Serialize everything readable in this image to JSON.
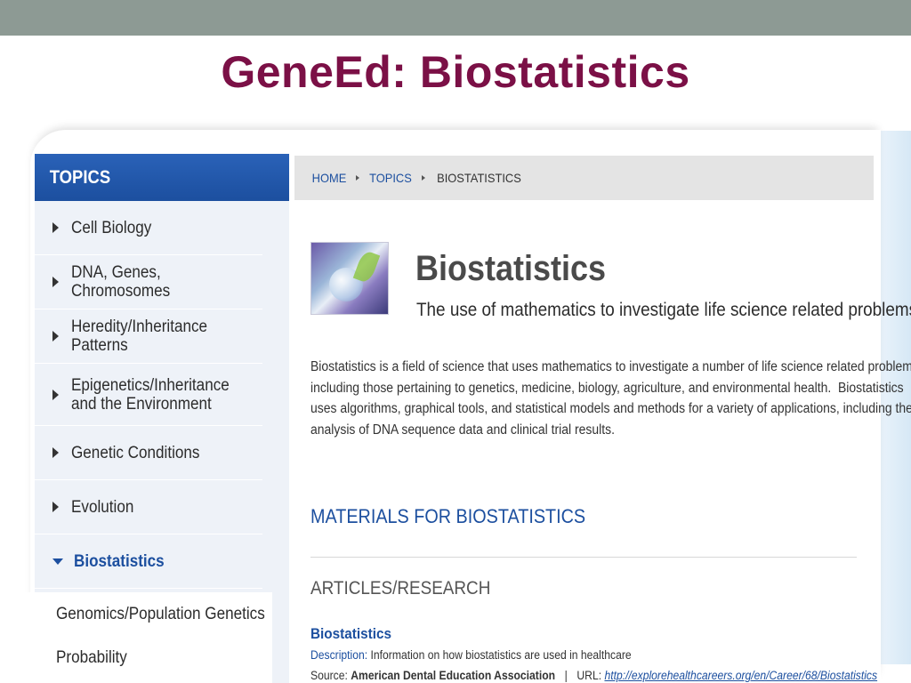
{
  "slide": {
    "title": "GeneEd: Biostatistics"
  },
  "sidebar": {
    "header": "TOPICS",
    "items": [
      {
        "label": "Cell Biology"
      },
      {
        "label": "DNA, Genes, Chromosomes"
      },
      {
        "label": "Heredity/Inheritance Patterns"
      },
      {
        "label": "Epigenetics/Inheritance and the Environment"
      },
      {
        "label": "Genetic Conditions"
      },
      {
        "label": "Evolution"
      },
      {
        "label": "Biostatistics"
      }
    ],
    "subitems": [
      {
        "label": "Genomics/Population Genetics"
      },
      {
        "label": "Probability"
      }
    ]
  },
  "breadcrumb": {
    "home": "HOME",
    "topics": "TOPICS",
    "current": "BIOSTATISTICS"
  },
  "main": {
    "heading": "Biostatistics",
    "subheading": "The use of mathematics to investigate life science related problems",
    "intro_lines": [
      "Biostatistics is a field of science that uses mathematics to investigate a number of life science related problems,",
      "including those pertaining to genetics, medicine, biology, agriculture, and environmental health.  Biostatistics",
      "uses algorithms, graphical tools, and statistical models and methods for a variety of applications, including the",
      "analysis of DNA sequence data and clinical trial results."
    ],
    "materials_heading": "MATERIALS FOR BIOSTATISTICS",
    "articles_heading": "ARTICLES/RESEARCH",
    "article": {
      "title": "Biostatistics",
      "desc_label": "Description:",
      "desc_text": "Information on how biostatistics are used in healthcare",
      "source_label": "Source:",
      "source_text": "American Dental Education Association",
      "separator": "|",
      "url_label": "URL:",
      "url": "http://explorehealthcareers.org/en/Career/68/Biostatistics"
    }
  }
}
